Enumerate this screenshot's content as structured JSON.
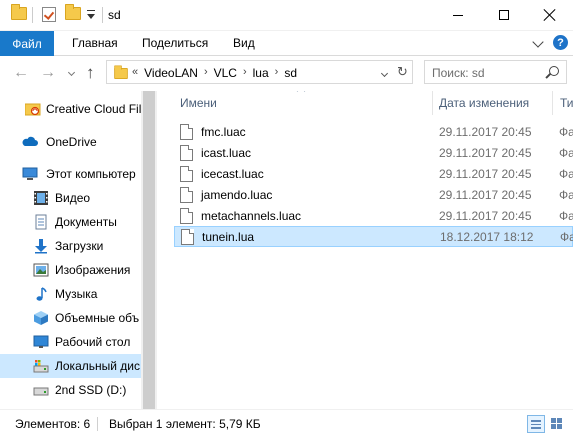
{
  "window": {
    "title": "sd",
    "minimize_icon": "minimize-icon",
    "maximize_icon": "maximize-icon",
    "close_icon": "close-icon"
  },
  "quick_access": [
    "folder-icon",
    "properties-check-icon",
    "new-folder-icon",
    "customize-dropdown-icon"
  ],
  "ribbon": {
    "file_tab": "Файл",
    "tabs": [
      "Главная",
      "Поделиться",
      "Вид"
    ],
    "accent_color": "#1979ca"
  },
  "address": {
    "back_icon": "←",
    "forward_icon": "→",
    "up_icon": "↑",
    "overflow": "«",
    "crumbs": [
      "VideoLAN",
      "VLC",
      "lua",
      "sd"
    ],
    "search_placeholder": "Поиск: sd"
  },
  "navigation": {
    "items": [
      {
        "label": "Creative Cloud Fil",
        "icon": "creative-cloud-icon"
      },
      {
        "label": "OneDrive",
        "icon": "onedrive-icon"
      },
      {
        "label": "Этот компьютер",
        "icon": "computer-icon"
      },
      {
        "label": "Видео",
        "icon": "video-icon"
      },
      {
        "label": "Документы",
        "icon": "documents-icon"
      },
      {
        "label": "Загрузки",
        "icon": "downloads-icon"
      },
      {
        "label": "Изображения",
        "icon": "pictures-icon"
      },
      {
        "label": "Музыка",
        "icon": "music-icon"
      },
      {
        "label": "Объемные объ",
        "icon": "3d-objects-icon"
      },
      {
        "label": "Рабочий стол",
        "icon": "desktop-icon"
      },
      {
        "label": "Локальный дис",
        "icon": "local-disk-icon",
        "selected": true
      },
      {
        "label": "2nd SSD (D:)",
        "icon": "drive-icon"
      }
    ]
  },
  "file_list": {
    "columns": [
      "Имени",
      "Дата изменения",
      "Ти"
    ],
    "files": [
      {
        "name": "fmc.luac",
        "date": "29.11.2017 20:45",
        "type": "Фа"
      },
      {
        "name": "icast.luac",
        "date": "29.11.2017 20:45",
        "type": "Фа"
      },
      {
        "name": "icecast.luac",
        "date": "29.11.2017 20:45",
        "type": "Фа"
      },
      {
        "name": "jamendo.luac",
        "date": "29.11.2017 20:45",
        "type": "Фа"
      },
      {
        "name": "metachannels.luac",
        "date": "29.11.2017 20:45",
        "type": "Фа"
      },
      {
        "name": "tunein.lua",
        "date": "18.12.2017 18:12",
        "type": "Фа",
        "selected": true
      }
    ]
  },
  "status": {
    "count": "Элементов: 6",
    "selection": "Выбран 1 элемент: 5,79 КБ",
    "view_details_icon": "details-view-icon",
    "view_tiles_icon": "large-icons-view-icon"
  }
}
